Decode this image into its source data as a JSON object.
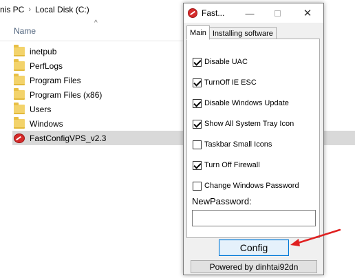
{
  "explorer": {
    "breadcrumb": [
      "nis PC",
      "Local Disk (C:)"
    ],
    "breadcrumb_separator": "›",
    "column_name": "Name",
    "sort_indicator": "^",
    "items": [
      {
        "label": "inetpub",
        "type": "folder",
        "icon": "folder-icon"
      },
      {
        "label": "PerfLogs",
        "type": "folder",
        "icon": "folder-icon"
      },
      {
        "label": "Program Files",
        "type": "folder",
        "icon": "folder-icon"
      },
      {
        "label": "Program Files (x86)",
        "type": "folder",
        "icon": "folder-icon"
      },
      {
        "label": "Users",
        "type": "folder",
        "icon": "folder-icon"
      },
      {
        "label": "Windows",
        "type": "folder",
        "icon": "folder-icon"
      },
      {
        "label": "FastConfigVPS_v2.3",
        "type": "application",
        "icon": "shield-app-icon",
        "selected": true
      }
    ]
  },
  "dialog": {
    "title": "Fast...",
    "window_controls": {
      "minimize": "—",
      "close": "✕"
    },
    "tabs": [
      {
        "label": "Main",
        "active": true
      },
      {
        "label": "Installing software",
        "active": false
      }
    ],
    "options": [
      {
        "label": "Disable UAC",
        "checked": true
      },
      {
        "label": "TurnOff IE ESC",
        "checked": true
      },
      {
        "label": "Disable Windows Update",
        "checked": true
      },
      {
        "label": "Show All System Tray Icon",
        "checked": true
      },
      {
        "label": "Taskbar Small Icons",
        "checked": false
      },
      {
        "label": "Turn Off Firewall",
        "checked": true
      },
      {
        "label": "Change Windows Password",
        "checked": false
      }
    ],
    "new_password_label": "NewPassword:",
    "new_password_value": "",
    "config_button": "Config",
    "powered_by": "Powered by dinhtai92dn"
  },
  "colors": {
    "accent": "#0078d7",
    "selection": "#d9d9d9",
    "annotation_arrow": "#e02020",
    "app_icon": "#d62b2b"
  }
}
